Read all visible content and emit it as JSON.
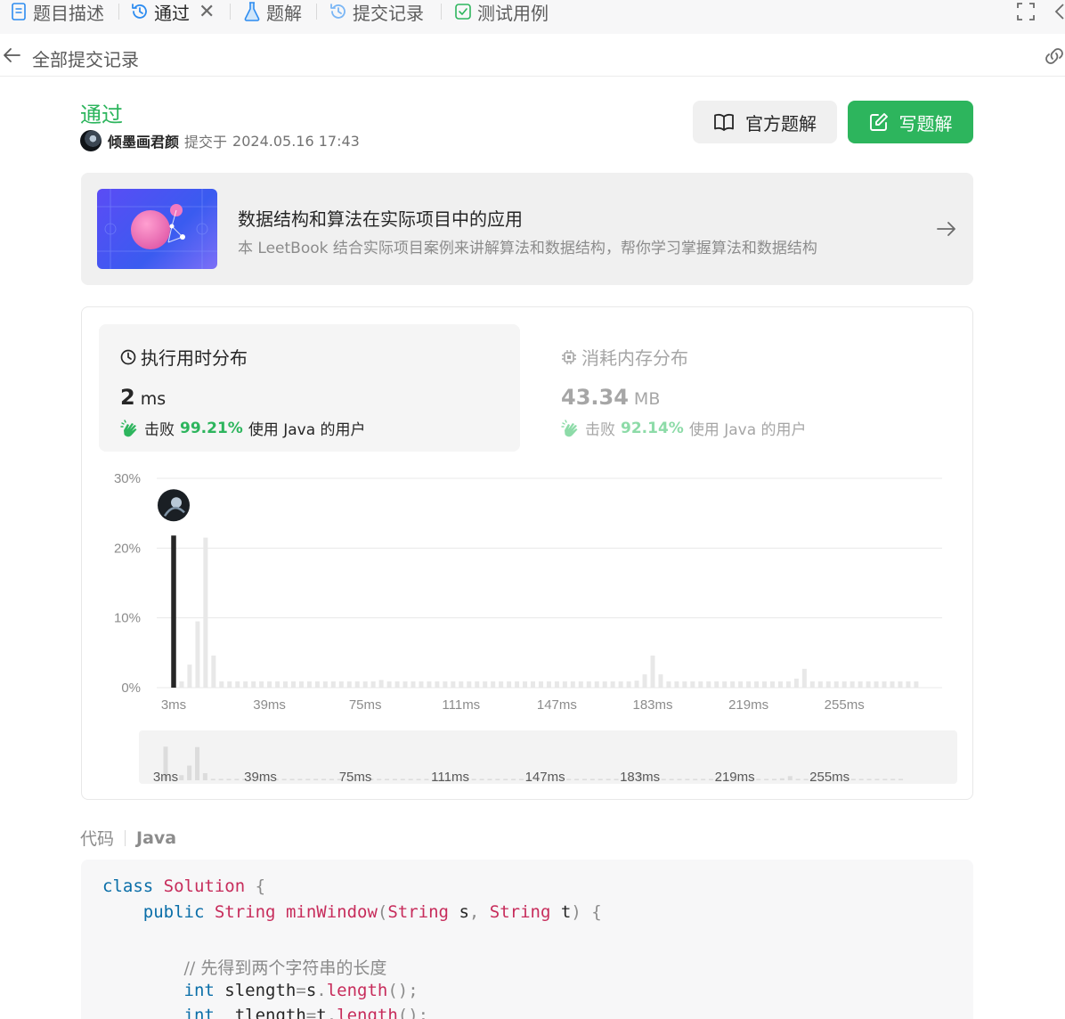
{
  "tabs": [
    {
      "label": "题目描述",
      "icon": "document-icon"
    },
    {
      "label": "通过",
      "icon": "history-icon",
      "active": true,
      "closable": true
    },
    {
      "label": "题解",
      "icon": "flask-icon"
    },
    {
      "label": "提交记录",
      "icon": "history-icon"
    },
    {
      "label": "测试用例",
      "icon": "checkbox-icon"
    }
  ],
  "back": {
    "label": "全部提交记录"
  },
  "submission": {
    "status": "通过",
    "username": "倾墨画君颜",
    "submitted_prefix": "提交于",
    "submitted_at": "2024.05.16 17:43"
  },
  "buttons": {
    "official": "官方题解",
    "write": "写题解"
  },
  "banner": {
    "title": "数据结构和算法在实际项目中的应用",
    "description": "本 LeetBook 结合实际项目案例来讲解算法和数据结构，帮你学习掌握算法和数据结构"
  },
  "runtime": {
    "title": "执行用时分布",
    "value": "2",
    "unit": "ms",
    "beat_label": "击败",
    "beat_pct": "99.21%",
    "beat_suffix": "使用 Java 的用户"
  },
  "memory": {
    "title": "消耗内存分布",
    "value": "43.34",
    "unit": "MB",
    "beat_label": "击败",
    "beat_pct": "92.14%",
    "beat_suffix": "使用 Java 的用户"
  },
  "colors": {
    "accent": "#2db55d",
    "highlight_bar": "#262626",
    "bar": "#e8e8e8"
  },
  "chart_data": {
    "type": "bar",
    "ylim": [
      0,
      30
    ],
    "y_ticks": [
      "0%",
      "10%",
      "20%",
      "30%"
    ],
    "x_ticks": [
      "3ms",
      "39ms",
      "75ms",
      "111ms",
      "147ms",
      "183ms",
      "219ms",
      "255ms"
    ],
    "grid": true,
    "highlight_x": 3,
    "x": [
      3,
      6,
      9,
      12,
      15,
      18,
      21,
      24,
      27,
      30,
      33,
      36,
      39,
      42,
      45,
      48,
      51,
      54,
      57,
      60,
      63,
      66,
      69,
      72,
      75,
      78,
      81,
      84,
      87,
      90,
      93,
      96,
      99,
      102,
      105,
      108,
      111,
      114,
      117,
      120,
      123,
      126,
      129,
      132,
      135,
      138,
      141,
      144,
      147,
      150,
      153,
      156,
      159,
      162,
      165,
      168,
      171,
      174,
      177,
      180,
      183,
      186,
      189,
      192,
      195,
      198,
      201,
      204,
      207,
      210,
      213,
      216,
      219,
      222,
      225,
      228,
      231,
      234,
      237,
      240,
      243,
      246,
      249,
      252,
      255,
      258,
      261,
      264,
      267,
      270,
      273,
      276,
      279,
      282
    ],
    "values": [
      21.8,
      0.9,
      3.3,
      9.5,
      21.5,
      4.6,
      0.9,
      0.9,
      0.9,
      0.9,
      0.9,
      0.9,
      0.9,
      0.9,
      0.9,
      0.9,
      0.9,
      0.9,
      0.9,
      0.9,
      0.9,
      0.9,
      0.9,
      0.9,
      0.9,
      0.9,
      1.1,
      0.9,
      0.9,
      0.9,
      0.9,
      0.9,
      0.9,
      0.9,
      0.9,
      0.9,
      0.9,
      0.9,
      0.9,
      0.9,
      0.9,
      0.9,
      0.9,
      0.9,
      0.9,
      0.9,
      0.9,
      0.9,
      0.9,
      0.9,
      0.9,
      0.9,
      0.9,
      0.9,
      0.9,
      0.9,
      0.9,
      0.9,
      1.0,
      1.9,
      4.6,
      1.9,
      0.9,
      0.9,
      0.9,
      0.9,
      0.9,
      0.9,
      0.9,
      0.9,
      0.9,
      0.9,
      0.9,
      0.9,
      0.9,
      0.9,
      0.9,
      0.9,
      1.3,
      2.7,
      0.9,
      0.9,
      0.9,
      0.9,
      0.9,
      0.9,
      0.9,
      0.9,
      0.9,
      0.9,
      0.9,
      0.9,
      0.9,
      0.9
    ]
  },
  "code": {
    "label": "代码",
    "language": "Java",
    "comment": "// 先得到两个字符串的长度"
  }
}
